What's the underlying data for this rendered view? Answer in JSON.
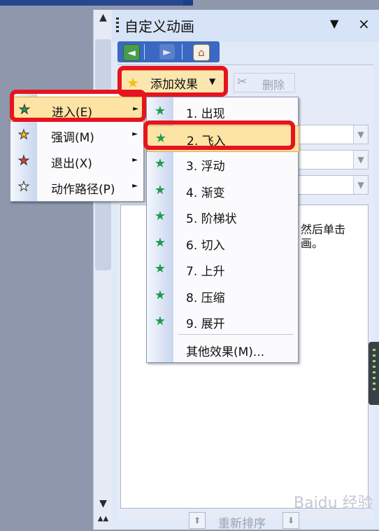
{
  "pane": {
    "title": "自定义动画",
    "menu_icon": "▼",
    "close_icon": "×",
    "nav": [
      {
        "icon": "back-arrow-icon",
        "glyph": "◄"
      },
      {
        "icon": "forward-arrow-icon",
        "glyph": "►"
      },
      {
        "icon": "home-icon",
        "glyph": "⌂"
      }
    ],
    "add_effect_label": "添加效果",
    "remove_label": "删除",
    "hint_line1": "然后单击",
    "hint_line2": "画。",
    "reorder_label": "重新排序"
  },
  "effect_menu": [
    {
      "label": "进入(E)",
      "icon": "entrance-star-icon",
      "color": "#1f9b4d",
      "selected": true
    },
    {
      "label": "强调(M)",
      "icon": "emphasis-star-icon",
      "color": "#f1c20c",
      "selected": false
    },
    {
      "label": "退出(X)",
      "icon": "exit-star-icon",
      "color": "#e4372a",
      "selected": false
    },
    {
      "label": "动作路径(P)",
      "icon": "motion-path-star-icon",
      "color": "#ffffff",
      "selected": false
    }
  ],
  "entrance_menu": [
    {
      "label": "1. 出现",
      "selected": false
    },
    {
      "label": "2. 飞入",
      "selected": true
    },
    {
      "label": "3. 浮动",
      "selected": false
    },
    {
      "label": "4. 渐变",
      "selected": false
    },
    {
      "label": "5. 阶梯状",
      "selected": false
    },
    {
      "label": "6. 切入",
      "selected": false
    },
    {
      "label": "7. 上升",
      "selected": false
    },
    {
      "label": "8. 压缩",
      "selected": false
    },
    {
      "label": "9. 展开",
      "selected": false
    }
  ],
  "more_effects_label": "其他效果(M)...",
  "watermark": "Baidu 经验",
  "colors": {
    "highlight": "#fde3a4",
    "red_outline": "#e6141e",
    "accent_blue": "#3a68c2"
  }
}
